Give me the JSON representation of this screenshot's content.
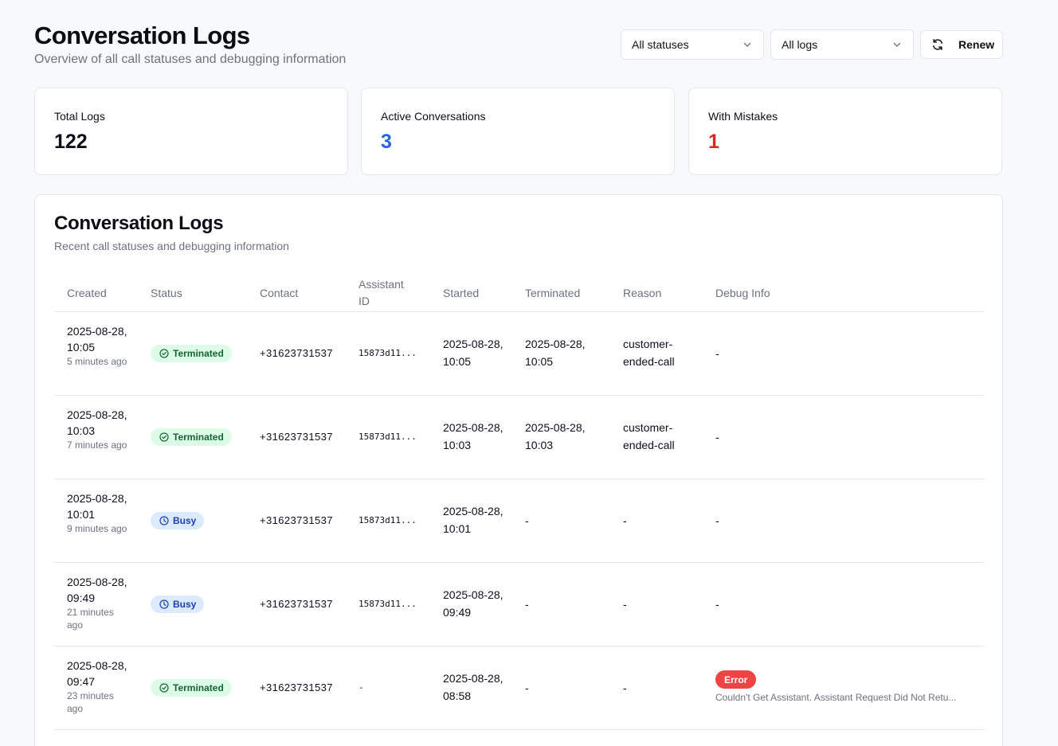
{
  "header": {
    "title": "Conversation Logs",
    "subtitle": "Overview of all call statuses and debugging information"
  },
  "filters": {
    "status_select": "All statuses",
    "log_select": "All logs",
    "renew_label": "Renew"
  },
  "stats": [
    {
      "label": "Total Logs",
      "value": "122",
      "color": "#0b0f1a"
    },
    {
      "label": "Active Conversations",
      "value": "3",
      "color": "#2563eb"
    },
    {
      "label": "With Mistakes",
      "value": "1",
      "color": "#dc2626"
    }
  ],
  "logs_card": {
    "title": "Conversation Logs",
    "subtitle": "Recent call statuses and debugging information",
    "columns": [
      "Created",
      "Status",
      "Contact",
      "Assistant ID",
      "Started",
      "Terminated",
      "Reason",
      "Debug Info"
    ],
    "rows": [
      {
        "created": "2025-08-28, 10:05",
        "created_rel": "5 minutes ago",
        "status": "Terminated",
        "contact": "+31623731537",
        "assistant_id": "15873d11...",
        "started": "2025-08-28, 10:05",
        "terminated": "2025-08-28, 10:05",
        "reason": "customer-ended-call",
        "debug": "-"
      },
      {
        "created": "2025-08-28, 10:03",
        "created_rel": "7 minutes ago",
        "status": "Terminated",
        "contact": "+31623731537",
        "assistant_id": "15873d11...",
        "started": "2025-08-28, 10:03",
        "terminated": "2025-08-28, 10:03",
        "reason": "customer-ended-call",
        "debug": "-"
      },
      {
        "created": "2025-08-28, 10:01",
        "created_rel": "9 minutes ago",
        "status": "Busy",
        "contact": "+31623731537",
        "assistant_id": "15873d11...",
        "started": "2025-08-28, 10:01",
        "terminated": "-",
        "reason": "-",
        "debug": "-"
      },
      {
        "created": "2025-08-28, 09:49",
        "created_rel": "21 minutes ago",
        "status": "Busy",
        "contact": "+31623731537",
        "assistant_id": "15873d11...",
        "started": "2025-08-28, 09:49",
        "terminated": "-",
        "reason": "-",
        "debug": "-"
      },
      {
        "created": "2025-08-28, 09:47",
        "created_rel": "23 minutes ago",
        "status": "Terminated",
        "contact": "+31623731537",
        "assistant_id": "-",
        "started": "2025-08-28, 08:58",
        "terminated": "-",
        "reason": "-",
        "debug_badge": "Error",
        "debug_text": "Couldn't Get Assistant. Assistant Request Did Not Retu..."
      }
    ]
  }
}
